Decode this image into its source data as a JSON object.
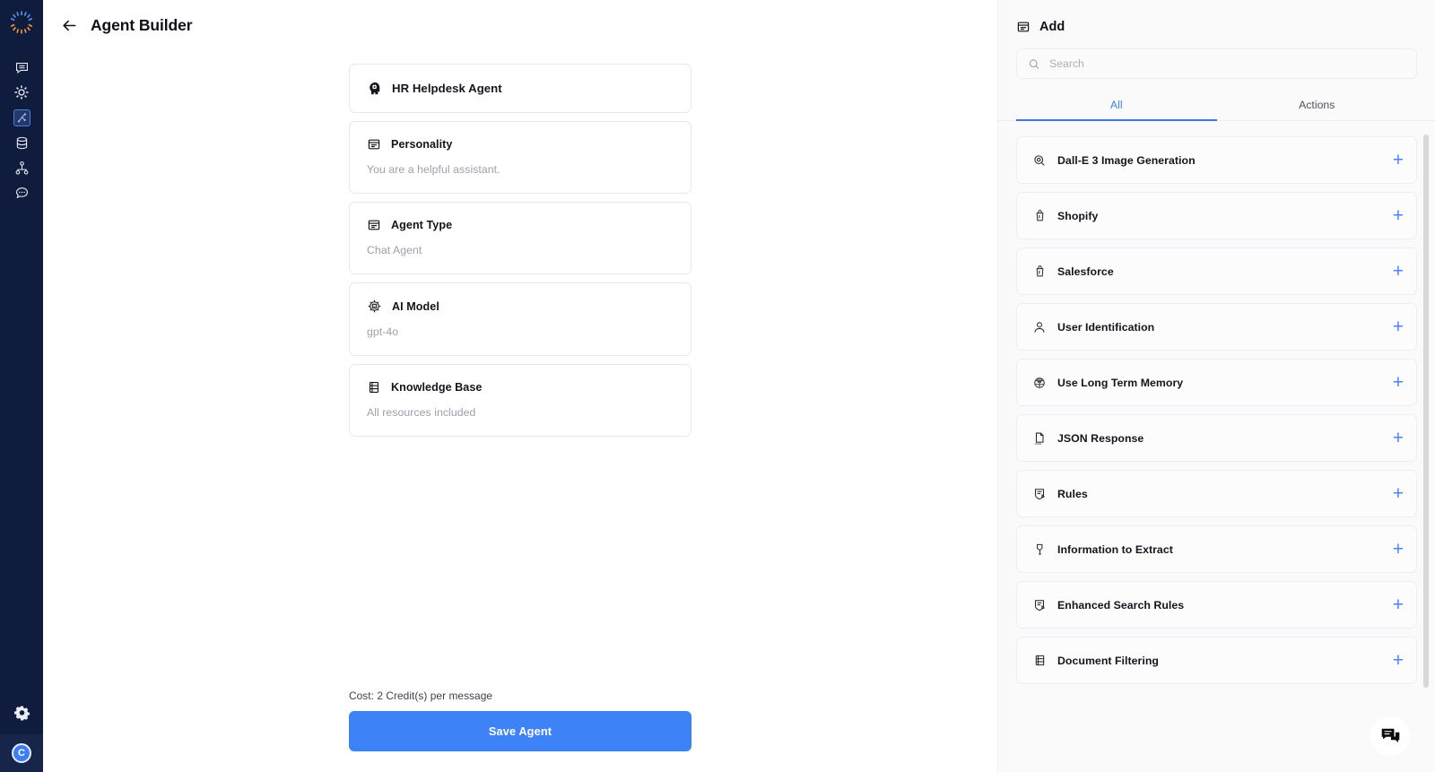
{
  "rail": {
    "logo_icon": "radial-burst-logo",
    "items": [
      {
        "icon": "chat-bubble-lines-icon",
        "name": "sidebar-item-conversations",
        "active": false
      },
      {
        "icon": "sun-gear-icon",
        "name": "sidebar-item-automations",
        "active": false
      },
      {
        "icon": "workflow-node-icon",
        "name": "sidebar-item-agent-builder",
        "active": true
      },
      {
        "icon": "database-icon",
        "name": "sidebar-item-knowledge",
        "active": false
      },
      {
        "icon": "org-tree-icon",
        "name": "sidebar-item-teams",
        "active": false
      },
      {
        "icon": "chat-dots-icon",
        "name": "sidebar-item-messages",
        "active": false
      }
    ],
    "gear_icon": "gear-icon",
    "avatar_initial": "C"
  },
  "header": {
    "back_icon": "arrow-left-icon",
    "title": "Agent Builder"
  },
  "builder": {
    "agent_name": "HR Helpdesk Agent",
    "agent_name_icon": "head-gear-icon",
    "fields": [
      {
        "icon": "card-lines-icon",
        "label": "Personality",
        "value": "You are a helpful assistant."
      },
      {
        "icon": "card-lines-icon",
        "label": "Agent Type",
        "value": "Chat Agent"
      },
      {
        "icon": "ai-chip-icon",
        "label": "AI Model",
        "value": "gpt-4o"
      },
      {
        "icon": "knowledge-stack-icon",
        "label": "Knowledge Base",
        "value": "All resources included"
      }
    ],
    "cost_text": "Cost: 2 Credit(s) per message",
    "save_label": "Save Agent"
  },
  "add_panel": {
    "icon": "card-lines-icon",
    "title": "Add",
    "search": {
      "icon": "search-icon",
      "placeholder": "Search",
      "value": ""
    },
    "tabs": [
      {
        "label": "All",
        "active": true
      },
      {
        "label": "Actions",
        "active": false
      }
    ],
    "items": [
      {
        "icon": "magnifier-image-icon",
        "label": "Dall-E 3 Image Generation",
        "action": "+"
      },
      {
        "icon": "shopping-bag-icon",
        "label": "Shopify",
        "action": "+"
      },
      {
        "icon": "shopping-bag-icon",
        "label": "Salesforce",
        "action": "+"
      },
      {
        "icon": "person-icon",
        "label": "User Identification",
        "action": "+"
      },
      {
        "icon": "brain-icon",
        "label": "Use Long Term Memory",
        "action": "+"
      },
      {
        "icon": "json-file-icon",
        "label": "JSON Response",
        "action": "+"
      },
      {
        "icon": "rules-badge-icon",
        "label": "Rules",
        "action": "+"
      },
      {
        "icon": "extract-pin-icon",
        "label": "Information to Extract",
        "action": "+"
      },
      {
        "icon": "rules-badge-icon",
        "label": "Enhanced Search Rules",
        "action": "+"
      },
      {
        "icon": "knowledge-stack-icon",
        "label": "Document Filtering",
        "action": "+"
      }
    ]
  },
  "chat_widget": {
    "icon": "chat-bubbles-icon"
  },
  "colors": {
    "rail_bg": "#101c3d",
    "accent_blue": "#3e82f7",
    "panel_bg": "#fafafa",
    "plus_blue": "#4a85f5",
    "muted_text": "#9ba0ab"
  }
}
